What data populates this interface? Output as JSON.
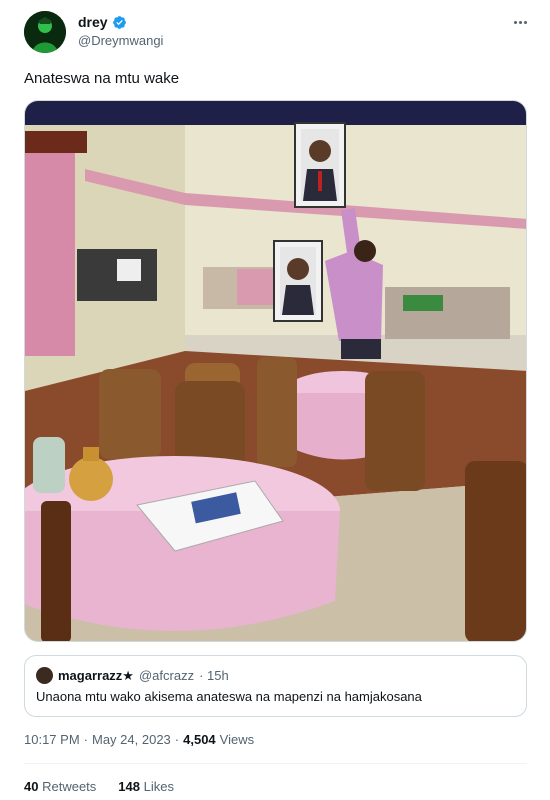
{
  "author": {
    "display_name": "drey",
    "handle": "@Dreymwangi",
    "avatar_icon": "avatar-icon",
    "verified_icon": "verified-badge-icon"
  },
  "tweet": {
    "text": "Anateswa na mtu wake",
    "media_alt": "Man in pink shirt adjusting framed portraits on a restaurant wall with pink tablecloths and wooden chairs"
  },
  "quote": {
    "display_name": "magarrazz★",
    "handle": "@afcrazz",
    "time": "· 15h",
    "text": "Unaona mtu wako akisema anateswa na mapenzi na hamjakosana"
  },
  "meta": {
    "time": "10:17 PM",
    "sep1": "·",
    "date": "May 24, 2023",
    "sep2": "·",
    "views_count": "4,504",
    "views_label": "Views"
  },
  "stats": {
    "retweets_count": "40",
    "retweets_label": "Retweets",
    "likes_count": "148",
    "likes_label": "Likes"
  },
  "colors": {
    "verified_blue": "#1d9bf0",
    "text_primary": "#0f1419",
    "text_secondary": "#536471",
    "border": "#cfd9de"
  }
}
